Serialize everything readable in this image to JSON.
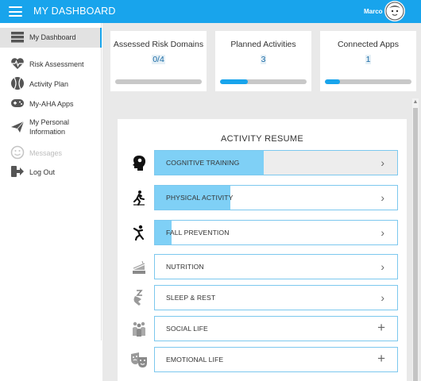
{
  "header": {
    "title": "MY DASHBOARD",
    "user_name": "Marco"
  },
  "sidebar": {
    "items": [
      {
        "label": "My Dashboard",
        "icon": "dashboard-icon"
      },
      {
        "label": "Risk Assessment",
        "icon": "heartbeat-icon"
      },
      {
        "label": "Activity Plan",
        "icon": "ball-icon"
      },
      {
        "label": "My-AHA Apps",
        "icon": "gamepad-icon"
      },
      {
        "label_line1": "My Personal",
        "label_line2": "Information",
        "icon": "paper-plane-icon"
      },
      {
        "label": "Messages",
        "icon": "smiley-icon"
      },
      {
        "label": "Log Out",
        "icon": "logout-icon"
      }
    ]
  },
  "stats": [
    {
      "title": "Assessed Risk Domains",
      "value": "0/4",
      "progress": 0
    },
    {
      "title": "Planned Activities",
      "value": "3",
      "progress": 0.32
    },
    {
      "title": "Connected Apps",
      "value": "1",
      "progress": 0.17
    }
  ],
  "resume": {
    "title": "ACTIVITY RESUME",
    "activities": [
      {
        "label": "COGNITIVE TRAINING",
        "icon": "brain-head-icon",
        "action": "›",
        "progress": 0.45
      },
      {
        "label": "PHYSICAL ACTIVITY",
        "icon": "running-icon",
        "action": "›",
        "progress": 0.31
      },
      {
        "label": "FALL PREVENTION",
        "icon": "falling-person-icon",
        "action": "›",
        "progress": 0.07
      },
      {
        "label": "NUTRITION",
        "icon": "cake-icon",
        "action": "›",
        "progress": 0
      },
      {
        "label": "SLEEP & REST",
        "icon": "sleep-icon",
        "action": "›",
        "progress": 0
      },
      {
        "label": "SOCIAL LIFE",
        "icon": "people-icon",
        "action": "+",
        "progress": 0
      },
      {
        "label": "EMOTIONAL LIFE",
        "icon": "theater-masks-icon",
        "action": "+",
        "progress": 0
      }
    ]
  },
  "colors": {
    "accent": "#18a4ec",
    "fill_light": "#7fd0f6"
  }
}
